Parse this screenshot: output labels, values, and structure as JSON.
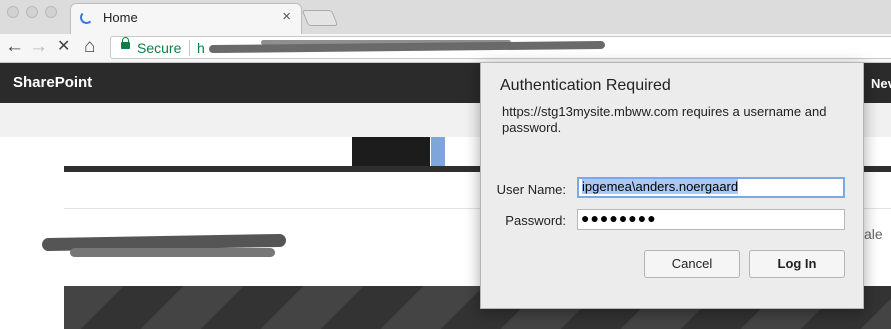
{
  "browser": {
    "tab_title": "Home",
    "tab_close": "×",
    "back_icon": "←",
    "forward_icon": "→",
    "stop_icon": "✕",
    "home_icon": "⌂",
    "secure_label": "Secure",
    "url_prefix": "h"
  },
  "sharepoint": {
    "brand": "SharePoint",
    "right_fragment": "Nev",
    "card_fragment": "ale"
  },
  "dialog": {
    "title": "Authentication Required",
    "message": "https://stg13mysite.mbww.com requires a username and password.",
    "username_label": "User Name:",
    "username_value": "ipgemea\\anders.noergaard",
    "password_label": "Password:",
    "password_masked": "●●●●●●●●",
    "cancel_label": "Cancel",
    "login_label": "Log In"
  },
  "colors": {
    "accent": "#3b78e7",
    "secure_green": "#0b8043",
    "sp_bar": "#2b2b2b"
  }
}
